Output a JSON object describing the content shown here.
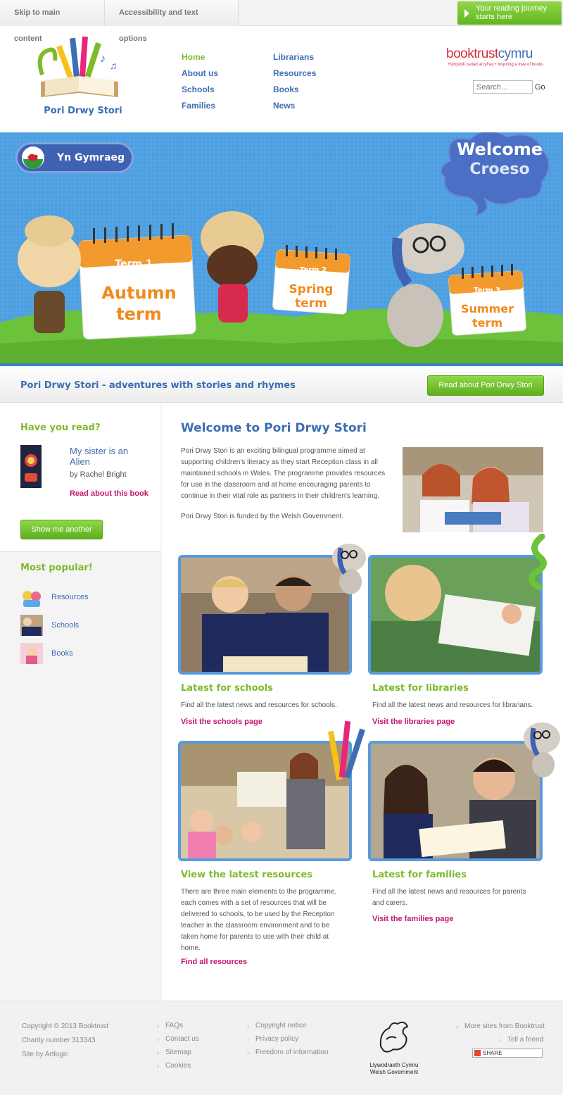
{
  "topbar": {
    "skip": "Skip to main content",
    "access": "Accessibility and text options",
    "journey_line1": "Your reading journey",
    "journey_line2": "starts here"
  },
  "logo": {
    "name": "Pori Drwy Stori"
  },
  "nav": {
    "col1": [
      "Home",
      "About us",
      "Schools",
      "Families"
    ],
    "col2": [
      "Librarians",
      "Resources",
      "Books",
      "News"
    ]
  },
  "booktrust": {
    "logo_a": "booktrust",
    "logo_b": "cymru",
    "tagline": "Ysbrydoli cariad at lyfrau • Inspiring a love of books"
  },
  "search": {
    "placeholder": "Search...",
    "go": "Go"
  },
  "hero": {
    "lang_button": "Yn Gymraeg",
    "welcome": "Welcome",
    "croeso": "Croeso",
    "term1_tab": "Term 1",
    "term1_line1": "Autumn",
    "term1_line2": "term",
    "term2_tab": "Term 2",
    "term2_line1": "Spring",
    "term2_line2": "term",
    "term3_tab": "Term 3",
    "term3_line1": "Summer",
    "term3_line2": "term"
  },
  "strap": {
    "text": "Pori Drwy Stori - adventures with stories and rhymes",
    "button": "Read about Pori Drwy Stori"
  },
  "sidebar": {
    "have_read": "Have you read?",
    "book_title_1": "My sister is an",
    "book_title_2": "Alien",
    "book_author": "by Rachel Bright",
    "book_link": "Read about this book",
    "show_another": "Show me another",
    "most_popular": "Most popular!",
    "popular": [
      "Resources",
      "Schools",
      "Books"
    ]
  },
  "main": {
    "heading": "Welcome to Pori Drwy Stori",
    "intro_lines": [
      "Pori Drwy Stori is an exciting bilingual programme aimed at",
      "supporting children's literacy as they start Reception class in all",
      "maintained schools in Wales. The programme provides resources",
      "for use in the classroom and at home encouraging parents to",
      "continue in their vital role as partners in their children's learning."
    ],
    "funded": "Pori Drwy Stori is funded by the Welsh Government.",
    "schools_h": "Latest for schools",
    "schools_text": "Find all the latest news and resources for schools.",
    "schools_link": "Visit the schools page",
    "libraries_h": "Latest for libraries",
    "libraries_text": "Find all the latest news and resources for librarians.",
    "libraries_link": "Visit the libraries page",
    "resources_h": "View the latest resources",
    "resources_lines": [
      "There are three main elements to the programme,",
      "each comes with a set of resources that will be",
      "delivered to schools, to be used by the Reception",
      "teacher in the classroom environment and to be",
      "taken home for parents to use with their child at",
      "home."
    ],
    "resources_link": "Find all resources",
    "families_h": "Latest for families",
    "families_lines": [
      "Find all the latest news and resources for parents",
      "and carers."
    ],
    "families_link": "Visit the families page"
  },
  "footer": {
    "copyright": "Copyright © 2013 Booktrust",
    "charity": "Charity number 313343",
    "site_by": "Site by Artlogic",
    "col1": [
      "FAQs",
      "Contact us",
      "Sitemap",
      "Cookies"
    ],
    "col2": [
      "Copyright notice",
      "Privacy policy",
      "Freedom of information"
    ],
    "gov_line1": "Llywodraeth Cymru",
    "gov_line2": "Welsh Government",
    "more_sites": "More sites from Booktrust",
    "tell_friend": "Tell a friend",
    "share": "SHARE"
  },
  "colors": {
    "accent_blue": "#3d6db3",
    "accent_green": "#7dbb2a",
    "link_pink": "#c4156f",
    "hero_blue": "#4f9fe0",
    "term_orange": "#f08a1c"
  }
}
